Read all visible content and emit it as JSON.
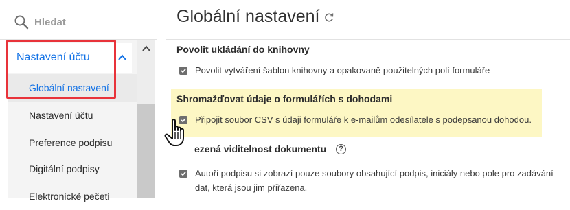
{
  "search": {
    "placeholder": "Hledat",
    "icon": "search-icon"
  },
  "sidebar": {
    "group_label": "Nastavení účtu",
    "items": [
      {
        "label": "Globální nastavení",
        "active": true
      },
      {
        "label": "Nastavení účtu"
      },
      {
        "label": "Preference podpisu"
      },
      {
        "label": "Digitální podpisy"
      },
      {
        "label": "Elektronické pečeti"
      }
    ]
  },
  "main": {
    "title": "Globální nastavení",
    "sections": [
      {
        "heading": "Povolit ukládání do knihovny",
        "checkbox_label": "Povolit vytváření šablon knihovny a opakovaně použitelných polí formuláře",
        "checked": true
      },
      {
        "heading": "Shromažďovat údaje o formulářích s dohodami",
        "checkbox_label": "Připojit soubor CSV s údaji formuláře k e-mailům odesílatele s podepsanou dohodou.",
        "checked": true,
        "highlighted": true
      },
      {
        "heading": "ezená viditelnost dokumentu",
        "help_glyph": "?",
        "checkbox_label_line1": "Autoři podpisu si zobrazí pouze soubory obsahující podpis, iniciály nebo pole pro zadávání",
        "checkbox_label_line2": "dat, která jsou jim přiřazena.",
        "checked": true
      }
    ]
  },
  "colors": {
    "accent": "#1473e6",
    "highlight_box": "#e8333a",
    "yellow": "#fdf7c4"
  }
}
